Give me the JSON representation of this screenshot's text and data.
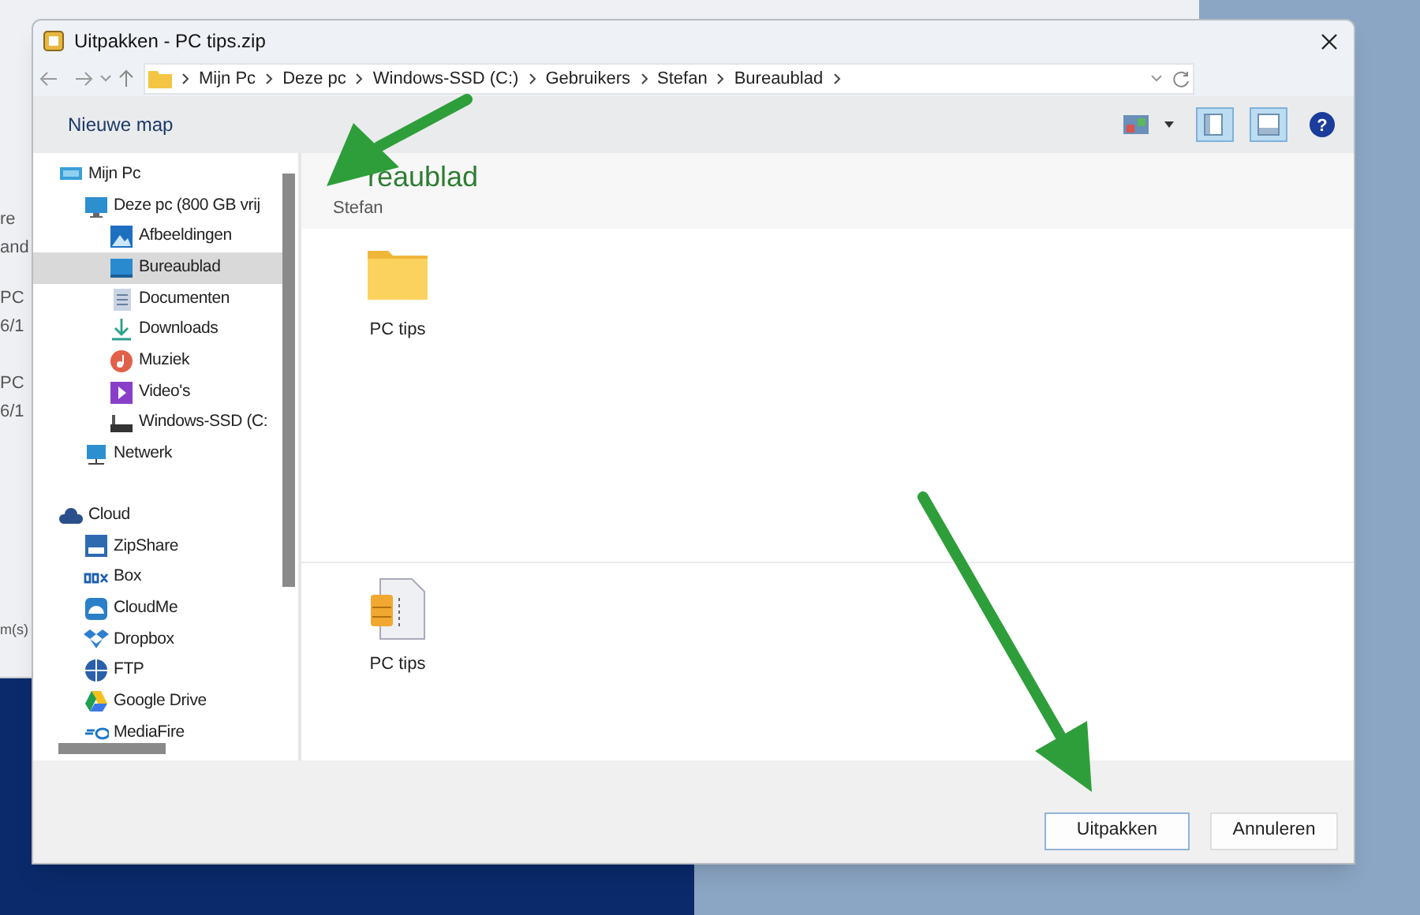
{
  "background_window": {
    "fragments": [
      "re",
      "and",
      "PC",
      "6/1",
      "PC",
      "6/1",
      "m(s)"
    ]
  },
  "window": {
    "title": "Uitpakken - PC tips.zip"
  },
  "address_bar": {
    "crumbs": [
      "Mijn Pc",
      "Deze pc",
      "Windows-SSD (C:)",
      "Gebruikers",
      "Stefan",
      "Bureaublad"
    ]
  },
  "toolbar": {
    "new_folder": "Nieuwe map",
    "help": "?",
    "views": [
      {
        "kind": "pane",
        "selected": true
      },
      {
        "kind": "preview",
        "selected": true
      }
    ]
  },
  "sidebar": {
    "items": [
      {
        "label": "Mijn Pc",
        "kind": "computer",
        "selected": false,
        "children": [
          {
            "label": "Deze pc (800 GB vrij",
            "kind": "monitor",
            "selected": false,
            "children": [
              {
                "label": "Afbeeldingen",
                "kind": "pictures",
                "selected": false
              },
              {
                "label": "Bureaublad",
                "kind": "desktop",
                "selected": true
              },
              {
                "label": "Documenten",
                "kind": "documents",
                "selected": false
              },
              {
                "label": "Downloads",
                "kind": "downloads",
                "selected": false
              },
              {
                "label": "Muziek",
                "kind": "music",
                "selected": false
              },
              {
                "label": "Video's",
                "kind": "videos",
                "selected": false
              },
              {
                "label": "Windows-SSD (C:",
                "kind": "drive",
                "selected": false
              }
            ]
          },
          {
            "label": "Netwerk",
            "kind": "network",
            "selected": false
          }
        ]
      },
      {
        "label": "Cloud",
        "kind": "cloud",
        "selected": false,
        "children": [
          {
            "label": "ZipShare",
            "kind": "zipshare",
            "selected": false
          },
          {
            "label": "Box",
            "kind": "box",
            "selected": false
          },
          {
            "label": "CloudMe",
            "kind": "cloudme",
            "selected": false
          },
          {
            "label": "Dropbox",
            "kind": "dropbox",
            "selected": false
          },
          {
            "label": "FTP",
            "kind": "ftp",
            "selected": false
          },
          {
            "label": "Google Drive",
            "kind": "gdrive",
            "selected": false
          },
          {
            "label": "MediaFire",
            "kind": "mediafire",
            "selected": false
          }
        ]
      }
    ]
  },
  "content": {
    "heading": "reaublad",
    "subheading": "Stefan",
    "sections": [
      {
        "items": [
          {
            "name": "PC tips",
            "kind": "folder"
          }
        ]
      },
      {
        "items": [
          {
            "name": "PC tips",
            "kind": "zip"
          }
        ]
      }
    ]
  },
  "buttons": [
    {
      "label": "Uitpakken",
      "default": true
    },
    {
      "label": "Annuleren",
      "default": false
    }
  ]
}
